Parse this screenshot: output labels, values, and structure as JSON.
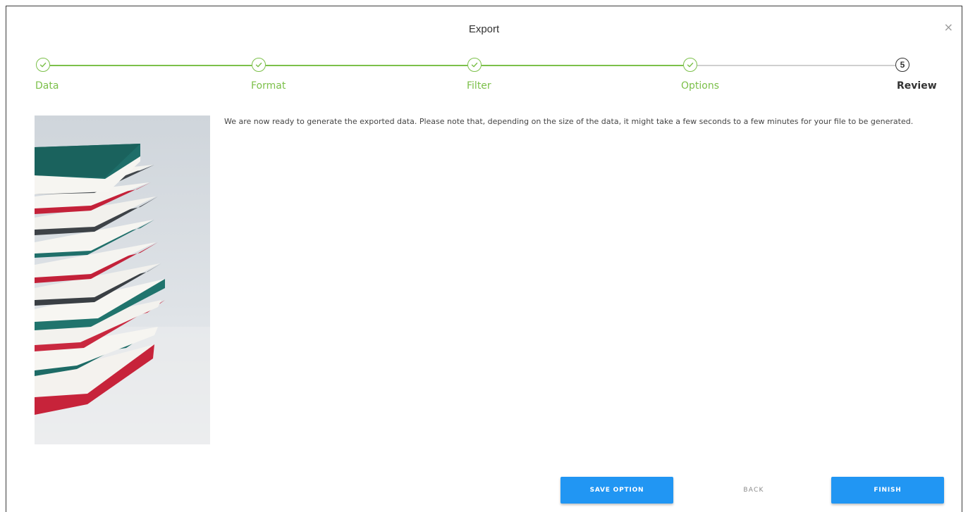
{
  "dialog": {
    "title": "Export",
    "close_glyph": "×"
  },
  "stepper": {
    "steps": [
      {
        "label": "Data",
        "status": "completed",
        "icon": "check-icon"
      },
      {
        "label": "Format",
        "status": "completed",
        "icon": "check-icon"
      },
      {
        "label": "Filter",
        "status": "completed",
        "icon": "check-icon"
      },
      {
        "label": "Options",
        "status": "completed",
        "icon": "check-icon"
      },
      {
        "label": "Review",
        "status": "active",
        "number": "5"
      }
    ],
    "completed_color": "#7cc04a",
    "pending_line_color": "#cfcfcf",
    "active_color": "#333333"
  },
  "content": {
    "message": "We are now ready to generate the exported data. Please note that, depending on the size of the data, it might take a few seconds to a few minutes for your file to be generated.",
    "image": "stack-of-books-illustration"
  },
  "actions": {
    "save_option_label": "SAVE OPTION",
    "back_label": "BACK",
    "finish_label": "FINISH",
    "primary_color": "#2196f3"
  }
}
